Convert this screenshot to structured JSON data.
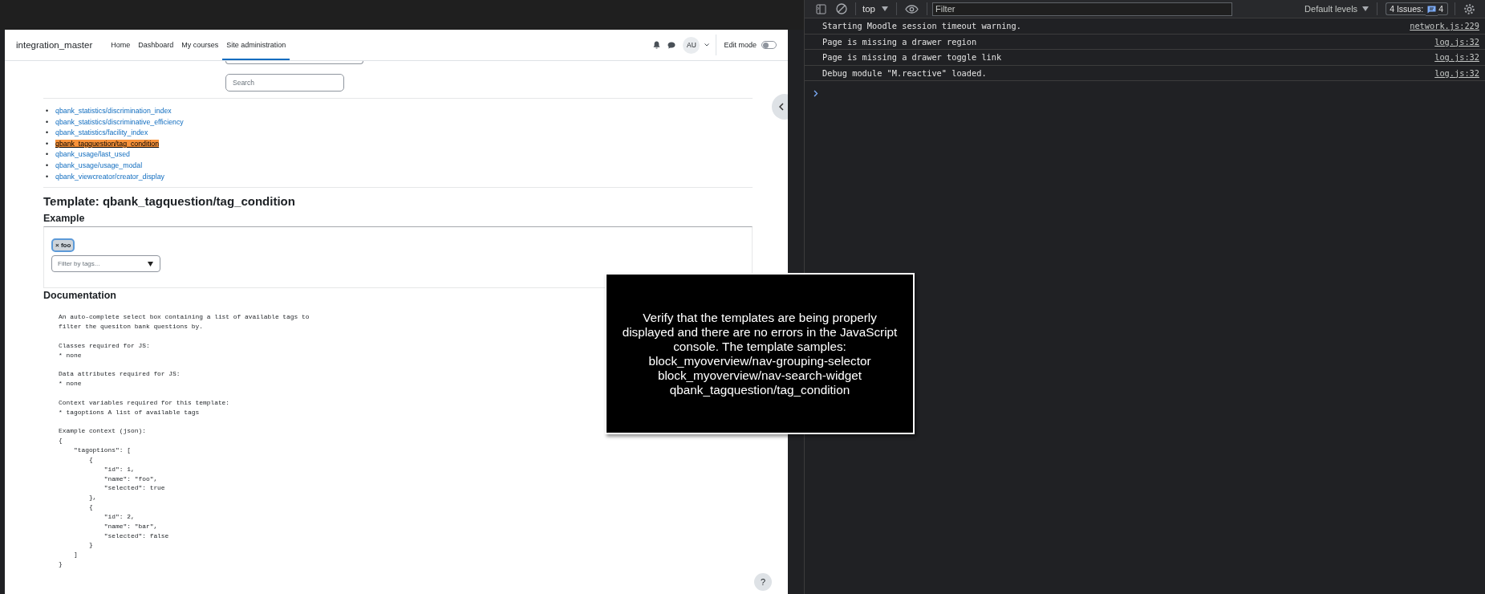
{
  "navbar": {
    "site_name": "integration_master",
    "items": [
      {
        "label": "Home",
        "selected": false
      },
      {
        "label": "Dashboard",
        "selected": false
      },
      {
        "label": "My courses",
        "selected": false
      },
      {
        "label": "Site administration",
        "selected": true
      }
    ],
    "avatar_initials": "AU",
    "edit_mode": {
      "label": "Edit mode",
      "on": false
    }
  },
  "search": {
    "placeholder": "Search"
  },
  "list_marker": "•",
  "template_links": [
    {
      "label": "qbank_statistics/discrimination_index",
      "selected": false
    },
    {
      "label": "qbank_statistics/discriminative_efficiency",
      "selected": false
    },
    {
      "label": "qbank_statistics/facility_index",
      "selected": false
    },
    {
      "label": "qbank_tagquestion/tag_condition",
      "selected": true
    },
    {
      "label": "qbank_usage/last_used",
      "selected": false
    },
    {
      "label": "qbank_usage/usage_modal",
      "selected": false
    },
    {
      "label": "qbank_viewcreator/creator_display",
      "selected": false
    }
  ],
  "template_heading": "Template: qbank_tagquestion/tag_condition",
  "example": {
    "heading": "Example",
    "tags": [
      {
        "label": "× foo"
      }
    ],
    "filter": {
      "placeholder": "Filter by tags..."
    }
  },
  "documentation": {
    "heading": "Documentation",
    "text": "An auto-complete select box containing a list of available tags to\nfilter the quesiton bank questions by.\n\nClasses required for JS:\n* none\n\nData attributes required for JS:\n* none\n\nContext variables required for this template:\n* tagoptions A list of available tags\n\nExample context (json):\n{\n    \"tagoptions\": [\n        {\n            \"id\": 1,\n            \"name\": \"foo\",\n            \"selected\": true\n        },\n        {\n            \"id\": 2,\n            \"name\": \"bar\",\n            \"selected\": false\n        }\n    ]\n}"
  },
  "help_button": "?",
  "overlay": {
    "text": "Verify that the templates are being properly\ndisplayed and there are no errors in the JavaScript\nconsole. The template samples:\nblock_myoverview/nav-grouping-selector\nblock_myoverview/nav-search-widget\nqbank_tagquestion/tag_condition"
  },
  "console": {
    "context": "top",
    "filter_placeholder": "Filter",
    "levels": "Default levels",
    "issues_label": "4 Issues:",
    "issues_count": "4",
    "messages": [
      {
        "text": "Starting Moodle session timeout warning.",
        "source": "network.js:229"
      },
      {
        "text": "Page is missing a drawer region",
        "source": "log.js:32"
      },
      {
        "text": "Page is missing a drawer toggle link",
        "source": "log.js:32"
      },
      {
        "text": "Debug module \"M.reactive\" loaded.",
        "source": "log.js:32"
      }
    ]
  }
}
